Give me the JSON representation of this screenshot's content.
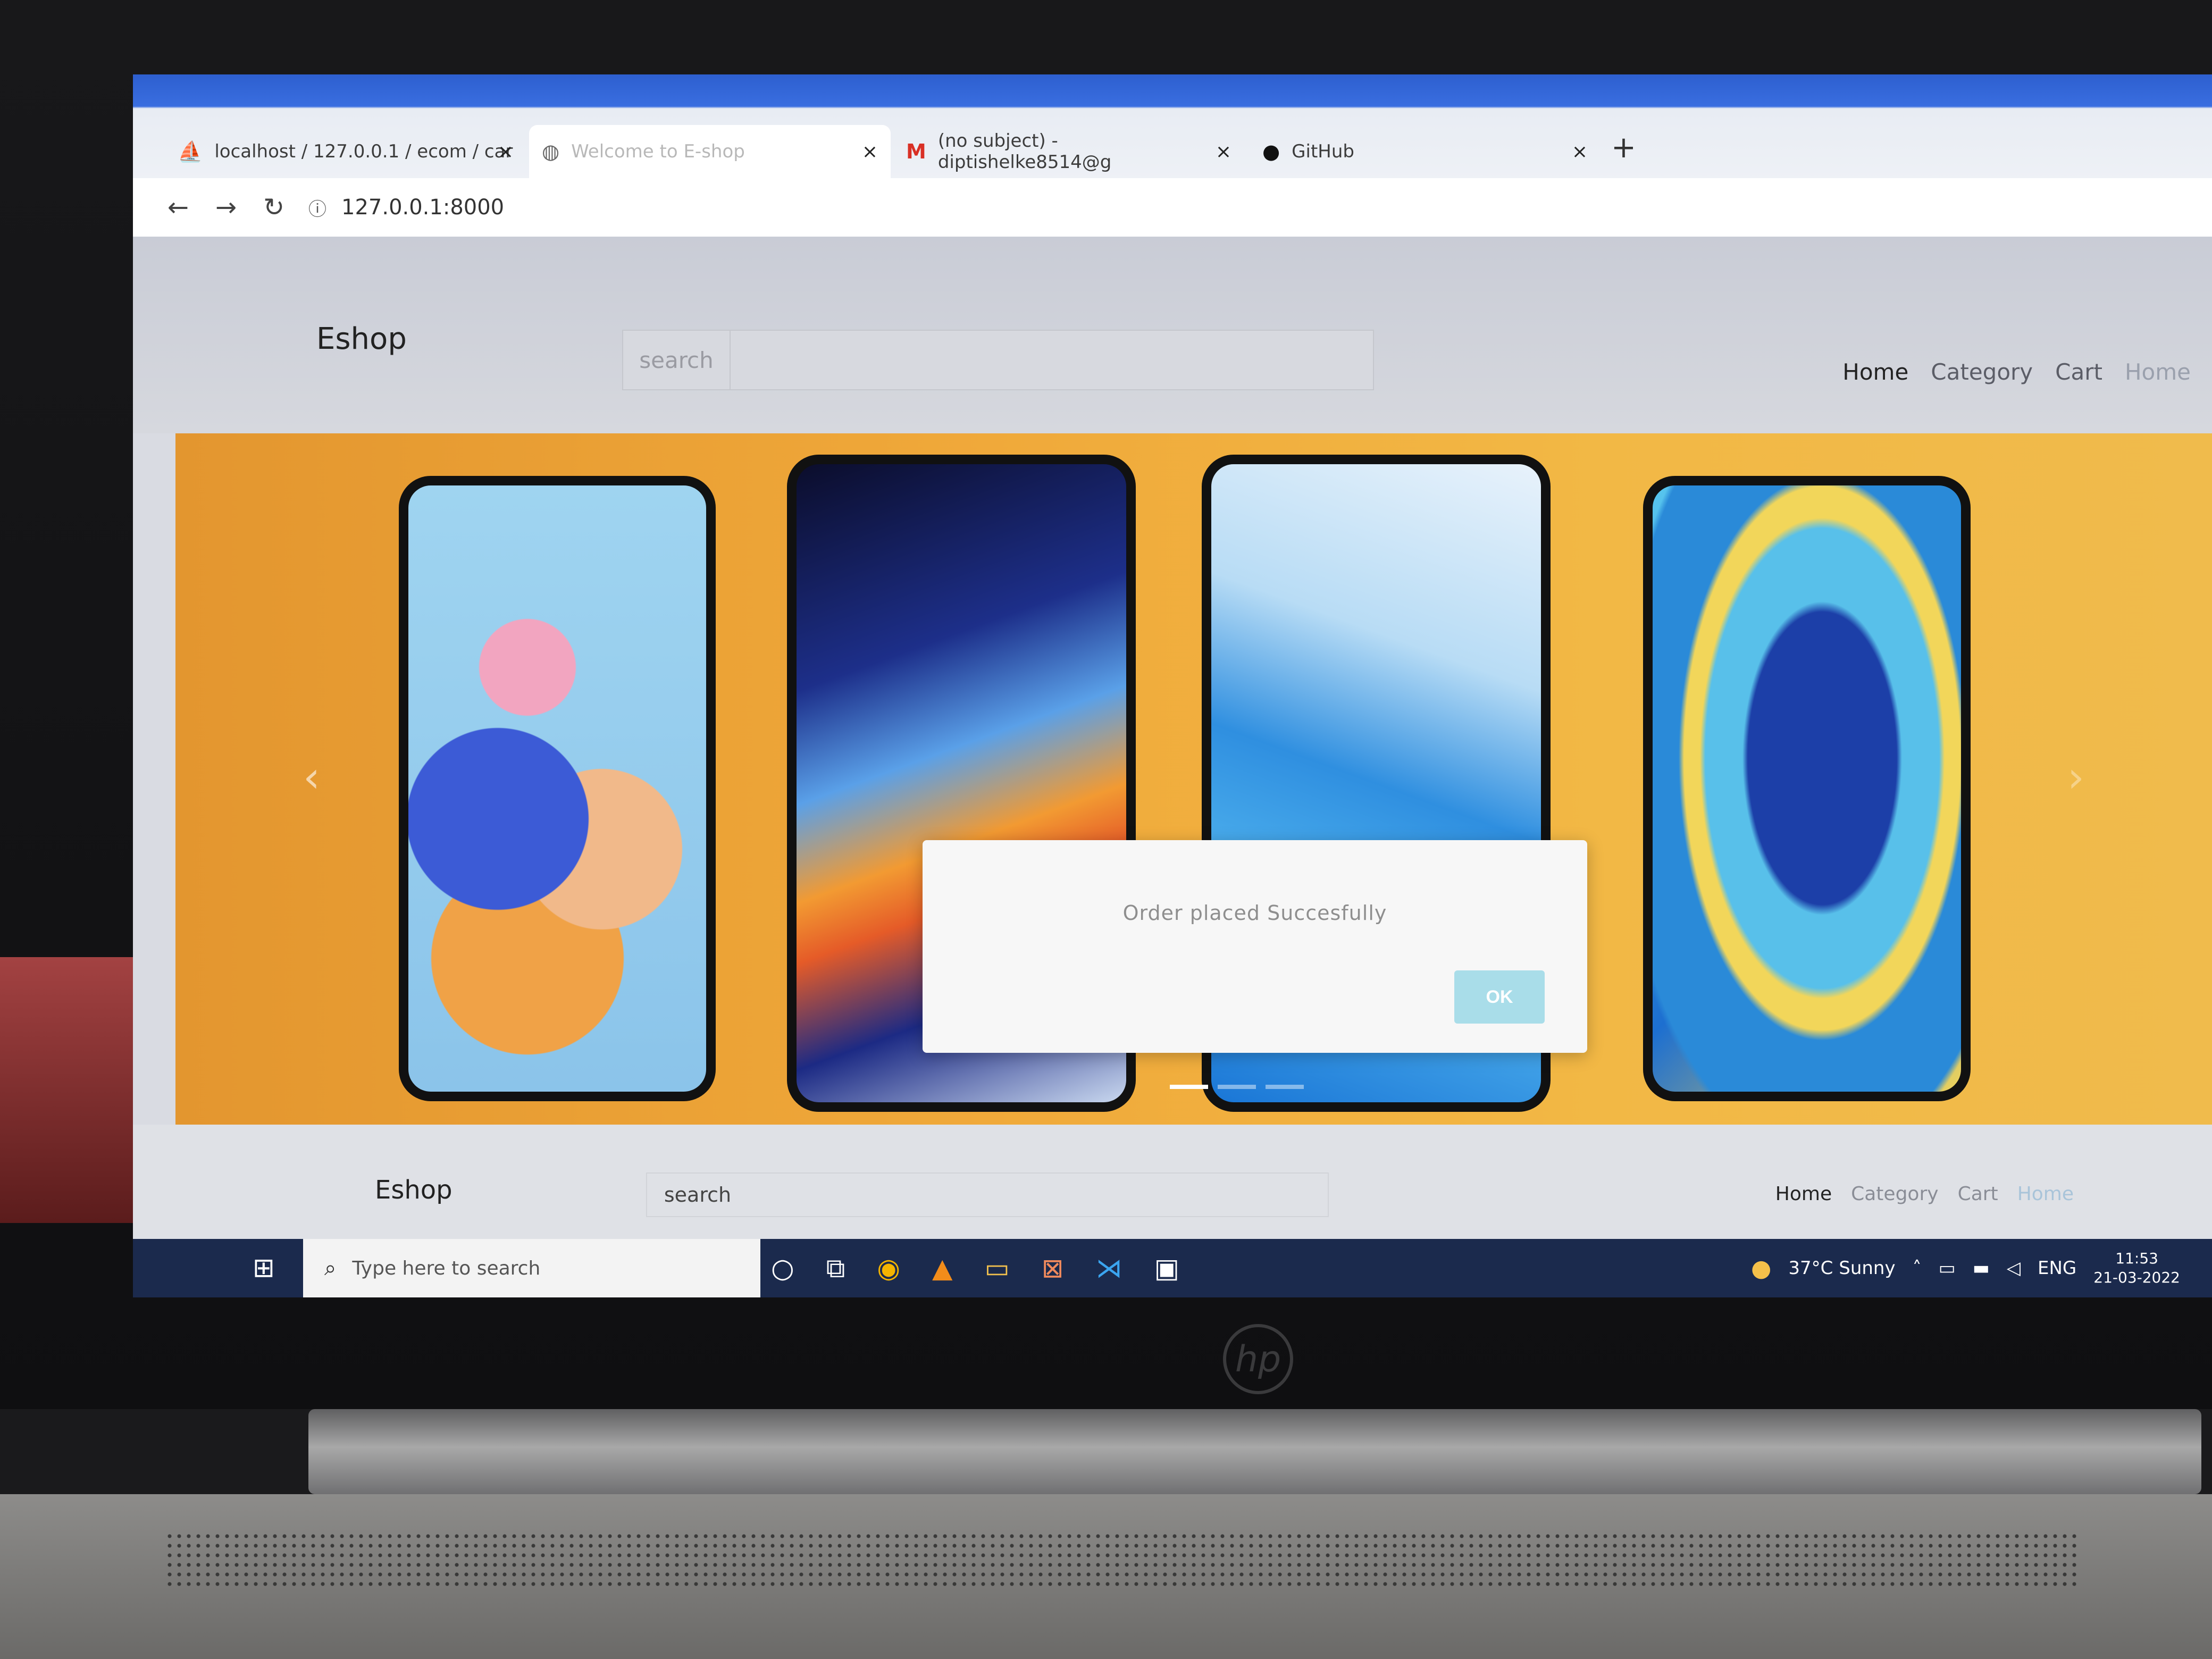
{
  "browser": {
    "tabs": [
      {
        "label": "localhost / 127.0.0.1 / ecom / car",
        "icon": "phpmyadmin-icon",
        "active": false
      },
      {
        "label": "Welcome to E-shop",
        "icon": "globe-icon",
        "active": true
      },
      {
        "label": "(no subject) - diptishelke8514@g",
        "icon": "gmail-icon",
        "active": false
      },
      {
        "label": "GitHub",
        "icon": "github-icon",
        "active": false
      }
    ],
    "close_glyph": "×",
    "new_tab_glyph": "+",
    "url": "127.0.0.1:8000"
  },
  "header": {
    "brand": "Eshop",
    "search_label": "search",
    "nav": [
      "Home",
      "Category",
      "Cart",
      "Home"
    ]
  },
  "carousel": {
    "slides": 3,
    "active_index": 0
  },
  "footer_header": {
    "brand": "Eshop",
    "search_label": "search",
    "nav": [
      "Home",
      "Category",
      "Cart",
      "Home"
    ]
  },
  "modal": {
    "message": "Order placed Succesfully",
    "ok_label": "OK"
  },
  "taskbar": {
    "search_placeholder": "Type here to search",
    "weather": "37°C  Sunny",
    "language": "ENG",
    "time": "11:53",
    "date": "21-03-2022"
  },
  "colors": {
    "ok_button": "#a9dde9",
    "carousel_bg": "#f0a93a",
    "taskbar": "#1b2a4d"
  }
}
